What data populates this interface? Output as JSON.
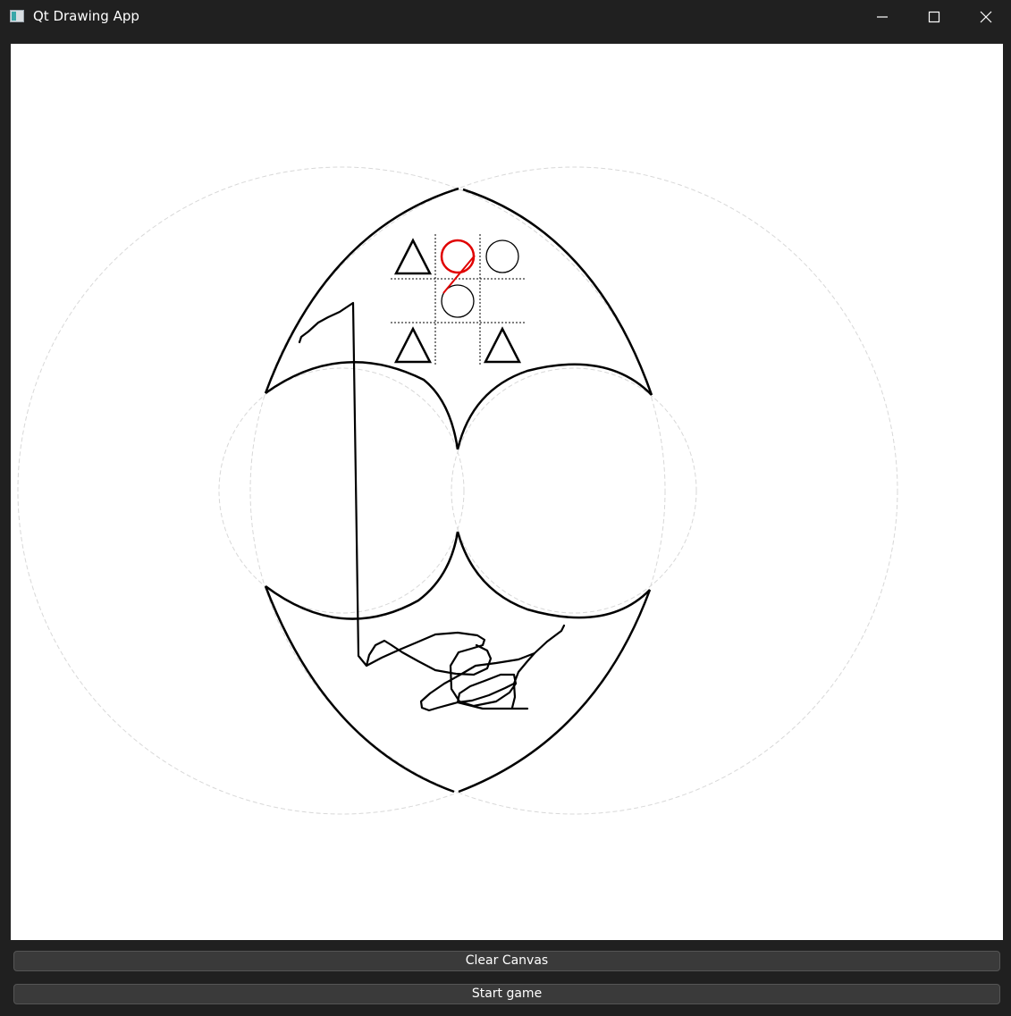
{
  "window": {
    "title": "Qt Drawing App",
    "icon": "app-window-icon"
  },
  "titlebar_controls": [
    "minimize-icon",
    "maximize-icon",
    "close-icon"
  ],
  "canvas": {
    "background": "#ffffff",
    "board": {
      "cells": [
        [
          "triangle",
          "circle-red",
          "circle"
        ],
        [
          "",
          "circle",
          ""
        ],
        [
          "triangle",
          "",
          "triangle"
        ]
      ]
    },
    "colors": {
      "stroke": "#000000",
      "highlight": "#e00000",
      "guide": "#d8d8d8"
    }
  },
  "buttons": {
    "clear_label": "Clear Canvas",
    "start_label": "Start game"
  }
}
